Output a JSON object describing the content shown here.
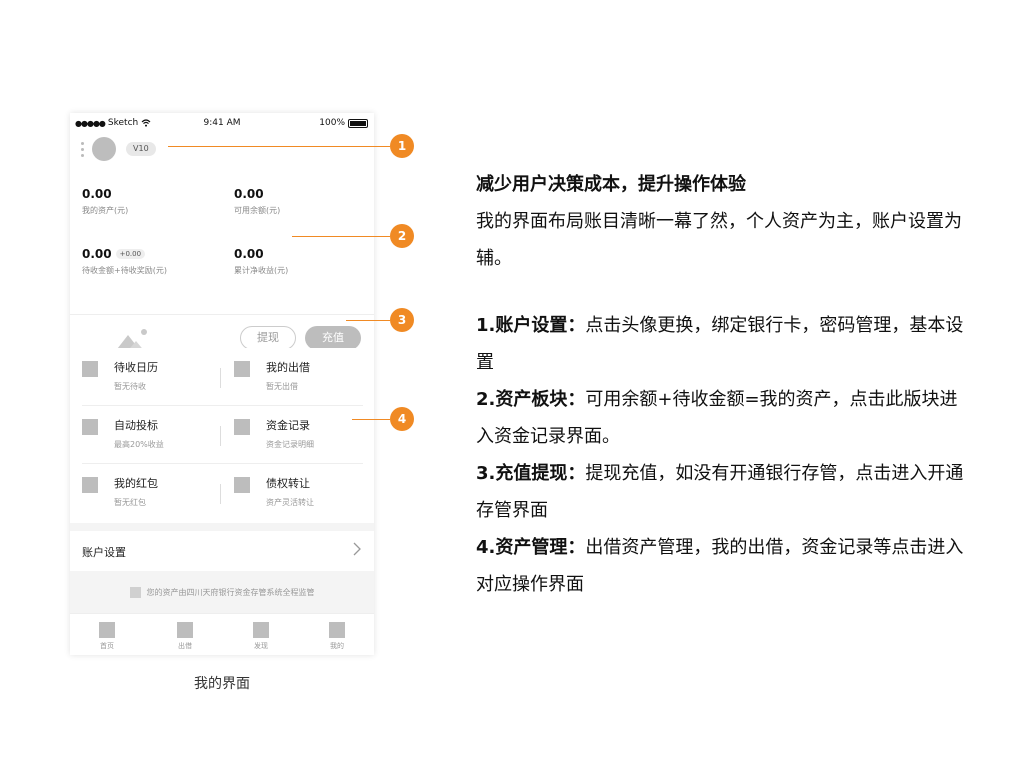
{
  "phone": {
    "status_bar": {
      "carrier": "Sketch",
      "time": "9:41 AM",
      "battery": "100%"
    },
    "vip": "V10",
    "stats": [
      {
        "value": "0.00",
        "label": "我的资产(元)"
      },
      {
        "value": "0.00",
        "label": "可用余额(元)"
      },
      {
        "value": "0.00",
        "badge": "+0.00",
        "label": "待收金额+待收奖励(元)"
      },
      {
        "value": "0.00",
        "label": "累计净收益(元)"
      }
    ],
    "actions": {
      "withdraw": "提现",
      "recharge": "充值"
    },
    "grid": [
      {
        "title": "待收日历",
        "sub": "暂无待收"
      },
      {
        "title": "我的出借",
        "sub": "暂无出借"
      },
      {
        "title": "自动投标",
        "sub": "最高20%收益"
      },
      {
        "title": "资金记录",
        "sub": "资金记录明细"
      },
      {
        "title": "我的红包",
        "sub": "暂无红包"
      },
      {
        "title": "债权转让",
        "sub": "资产灵活转让"
      }
    ],
    "settings": "账户设置",
    "notice": "您的资产由四川天府银行资金存管系统全程监管",
    "tabs": [
      "首页",
      "出借",
      "发现",
      "我的"
    ]
  },
  "caption": "我的界面",
  "callouts": [
    "1",
    "2",
    "3",
    "4"
  ],
  "description": {
    "title": "减少用户决策成本，提升操作体验",
    "intro": "我的界面布局账目清晰一幕了然，个人资产为主，账户设置为辅。",
    "items": [
      {
        "head": "1.账户设置：",
        "body": "点击头像更换，绑定银行卡，密码管理，基本设置"
      },
      {
        "head": "2.资产板块：",
        "body": "可用余额+待收金额=我的资产，点击此版块进入资金记录界面。"
      },
      {
        "head": "3.充值提现：",
        "body": "提现充值，如没有开通银行存管，点击进入开通存管界面"
      },
      {
        "head": "4.资产管理：",
        "body": "出借资产管理，我的出借，资金记录等点击进入对应操作界面"
      }
    ]
  },
  "colors": {
    "accent": "#f08a24",
    "placeholder": "#bdbdbd"
  }
}
